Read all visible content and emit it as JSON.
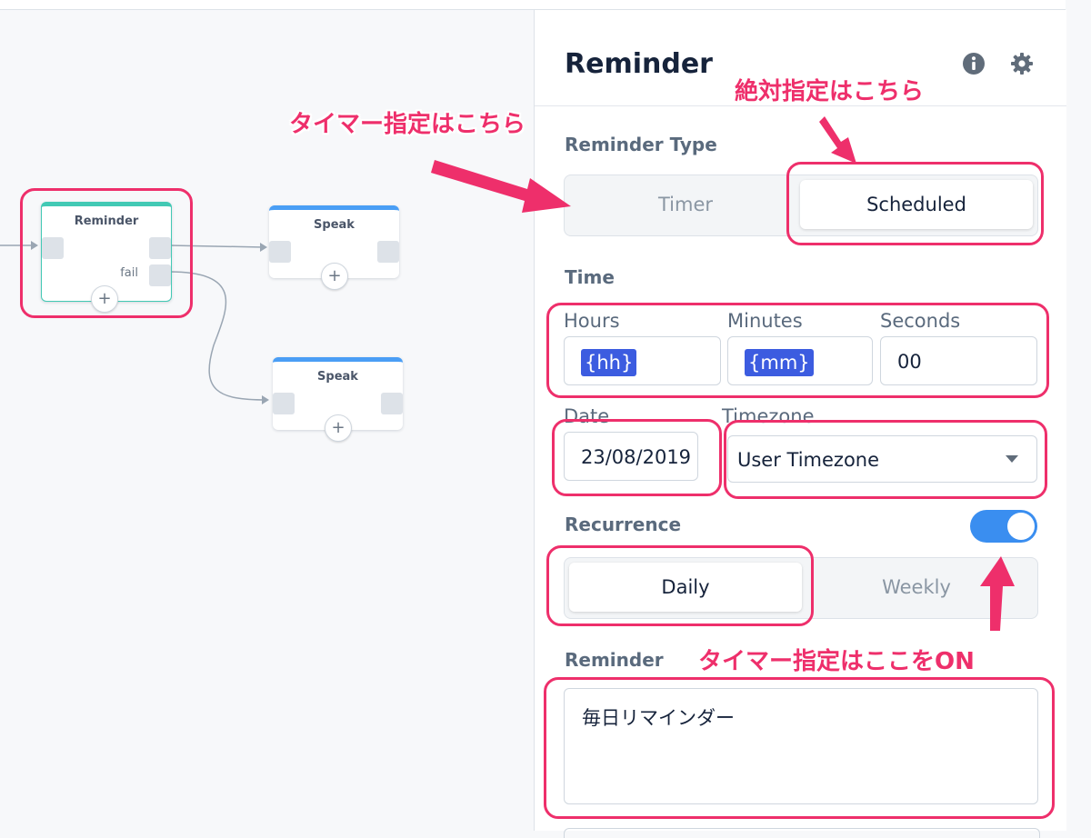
{
  "canvas": {
    "nodes": [
      {
        "title": "Reminder",
        "fail_label": "fail",
        "add": "+"
      },
      {
        "title": "Speak",
        "add": "+"
      },
      {
        "title": "Speak",
        "add": "+"
      }
    ]
  },
  "panel": {
    "title": "Reminder",
    "icons": [
      "info-icon",
      "gear-icon"
    ],
    "reminder_type": {
      "label": "Reminder Type",
      "options": [
        "Timer",
        "Scheduled"
      ],
      "selected": "Scheduled"
    },
    "time": {
      "label": "Time",
      "hours": {
        "label": "Hours",
        "value": "{hh}"
      },
      "minutes": {
        "label": "Minutes",
        "value": "{mm}"
      },
      "seconds": {
        "label": "Seconds",
        "value": "00"
      }
    },
    "date": {
      "label": "Date",
      "value": "23/08/2019"
    },
    "timezone": {
      "label": "Timezone",
      "value": "User Timezone"
    },
    "recurrence": {
      "label": "Recurrence",
      "enabled": true,
      "options": [
        "Daily",
        "Weekly"
      ],
      "selected": "Daily"
    },
    "reminder": {
      "label": "Reminder",
      "value": "毎日リマインダー"
    }
  },
  "annotations": {
    "timer": "タイマー指定はこちら",
    "absolute": "絶対指定はこちら",
    "toggle_on": "タイマー指定はここをON"
  },
  "colors": {
    "accent": "#3a8ef0",
    "annotation": "#ee2f6b",
    "selected_node": "#42c9b4",
    "variable_chip": "#3c5ce0"
  }
}
